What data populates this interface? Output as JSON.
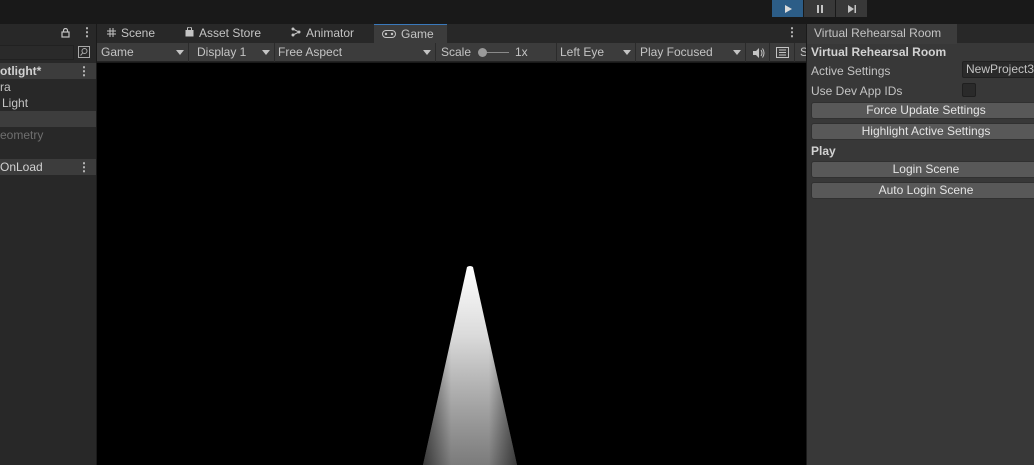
{
  "toolbar": {
    "play_buttons": [
      {
        "name": "play",
        "active": true
      },
      {
        "name": "pause",
        "active": false
      },
      {
        "name": "step",
        "active": false
      }
    ],
    "active_color": "#2c5d87"
  },
  "hierarchy": {
    "scene_name": "otlight*",
    "items": [
      "ra",
      "Light",
      "",
      "eometry",
      "",
      "OnLoad"
    ]
  },
  "tabs": [
    {
      "label": "Scene",
      "icon": "grid-icon"
    },
    {
      "label": "Asset Store",
      "icon": "bag-icon"
    },
    {
      "label": "Animator",
      "icon": "animator-icon"
    },
    {
      "label": "Game",
      "icon": "gamepad-icon"
    }
  ],
  "game_toolbar": {
    "mode": "Game",
    "display": "Display 1",
    "aspect": "Free Aspect",
    "scale_label": "Scale",
    "scale_value": "1x",
    "eye": "Left Eye",
    "play_mode": "Play Focused",
    "trailing": "S"
  },
  "inspector": {
    "tab_title": "Virtual Rehearsal Room",
    "header": "Virtual Rehearsal Room",
    "active_settings_label": "Active Settings",
    "active_settings_value": "NewProject3",
    "use_dev_label": "Use Dev App IDs",
    "force_update": "Force Update Settings",
    "highlight_active": "Highlight Active Settings",
    "play_header": "Play",
    "login_scene": "Login Scene",
    "auto_login_scene": "Auto Login Scene"
  }
}
